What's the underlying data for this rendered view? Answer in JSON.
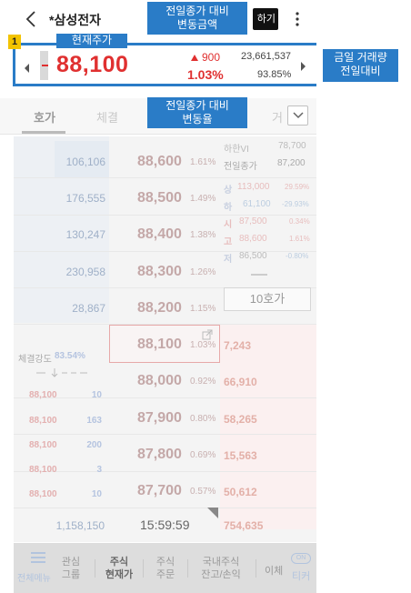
{
  "header": {
    "stock_name": "*삼성전자",
    "right_button": "하기"
  },
  "price_header": {
    "current_price": "88,100",
    "change_amount": "900",
    "change_rate": "1.03%",
    "volume": "23,661,537",
    "volume_ratio": "93.85%"
  },
  "tabs": [
    {
      "label": "호가"
    },
    {
      "label": "체결"
    },
    {
      "label": "거"
    }
  ],
  "ask_rows": [
    {
      "qty": "106,106",
      "price": "88,600",
      "pct": "1.61%"
    },
    {
      "qty": "176,555",
      "price": "88,500",
      "pct": "1.49%"
    },
    {
      "qty": "130,247",
      "price": "88,400",
      "pct": "1.38%"
    },
    {
      "qty": "230,958",
      "price": "88,300",
      "pct": "1.26%"
    },
    {
      "qty": "28,867",
      "price": "88,200",
      "pct": "1.15%"
    }
  ],
  "bid_rows": [
    {
      "price": "88,100",
      "pct": "1.03%",
      "qty": "7,243"
    },
    {
      "price": "88,000",
      "pct": "0.92%",
      "qty": "66,910"
    },
    {
      "price": "87,900",
      "pct": "0.80%",
      "qty": "58,265"
    },
    {
      "price": "87,800",
      "pct": "0.69%",
      "qty": "15,563"
    },
    {
      "price": "87,700",
      "pct": "0.57%",
      "qty": "50,612"
    }
  ],
  "side_info": {
    "lower_limit_label": "하한VI",
    "lower_limit_value": "78,700",
    "prev_close_label": "전일종가",
    "prev_close_value": "87,200",
    "stats": [
      {
        "label": "상",
        "value": "113,000",
        "pct": "29.59%"
      },
      {
        "label": "하",
        "value": "61,100",
        "pct": "-29.93%"
      },
      {
        "label": "시",
        "value": "87,500",
        "pct": "0.34%"
      },
      {
        "label": "고",
        "value": "88,600",
        "pct": "1.61%"
      },
      {
        "label": "저",
        "value": "86,500",
        "pct": "-0.80%"
      }
    ],
    "ten_hoga_button": "10호가"
  },
  "execution": {
    "strength_label": "체결강도",
    "strength_value": "83.54%",
    "trades": [
      {
        "price": "88,100",
        "volume": "10"
      },
      {
        "price": "88,100",
        "volume": "163"
      },
      {
        "price": "88,100",
        "volume": "200"
      },
      {
        "price": "88,100",
        "volume": "3"
      },
      {
        "price": "88,100",
        "volume": "10"
      }
    ]
  },
  "totals": {
    "ask_total": "1,158,150",
    "time": "15:59:59",
    "bid_total": "754,635"
  },
  "bottom_nav": {
    "menu_label": "전체메뉴",
    "items": [
      {
        "line1": "관심",
        "line2": "그룹"
      },
      {
        "line1": "주식",
        "line2": "현재가"
      },
      {
        "line1": "주식",
        "line2": "주문"
      },
      {
        "line1": "국내주식",
        "line2": "잔고/손익"
      }
    ],
    "next_label": "이체",
    "ai_badge": "ON",
    "ai_label": "티커"
  },
  "annotations": {
    "badge_number": "1",
    "current_price_label": "현재주가",
    "change_amount_label_1": "전일종가 대비",
    "change_amount_label_2": "변동금액",
    "change_rate_label_1": "전일종가 대비",
    "change_rate_label_2": "변동율",
    "volume_label_1": "금일 거래량",
    "volume_label_2": "전일대비"
  },
  "colors": {
    "accent_blue": "#2a7cc7",
    "price_up_red": "#e03030",
    "badge_yellow": "#f2c300"
  }
}
